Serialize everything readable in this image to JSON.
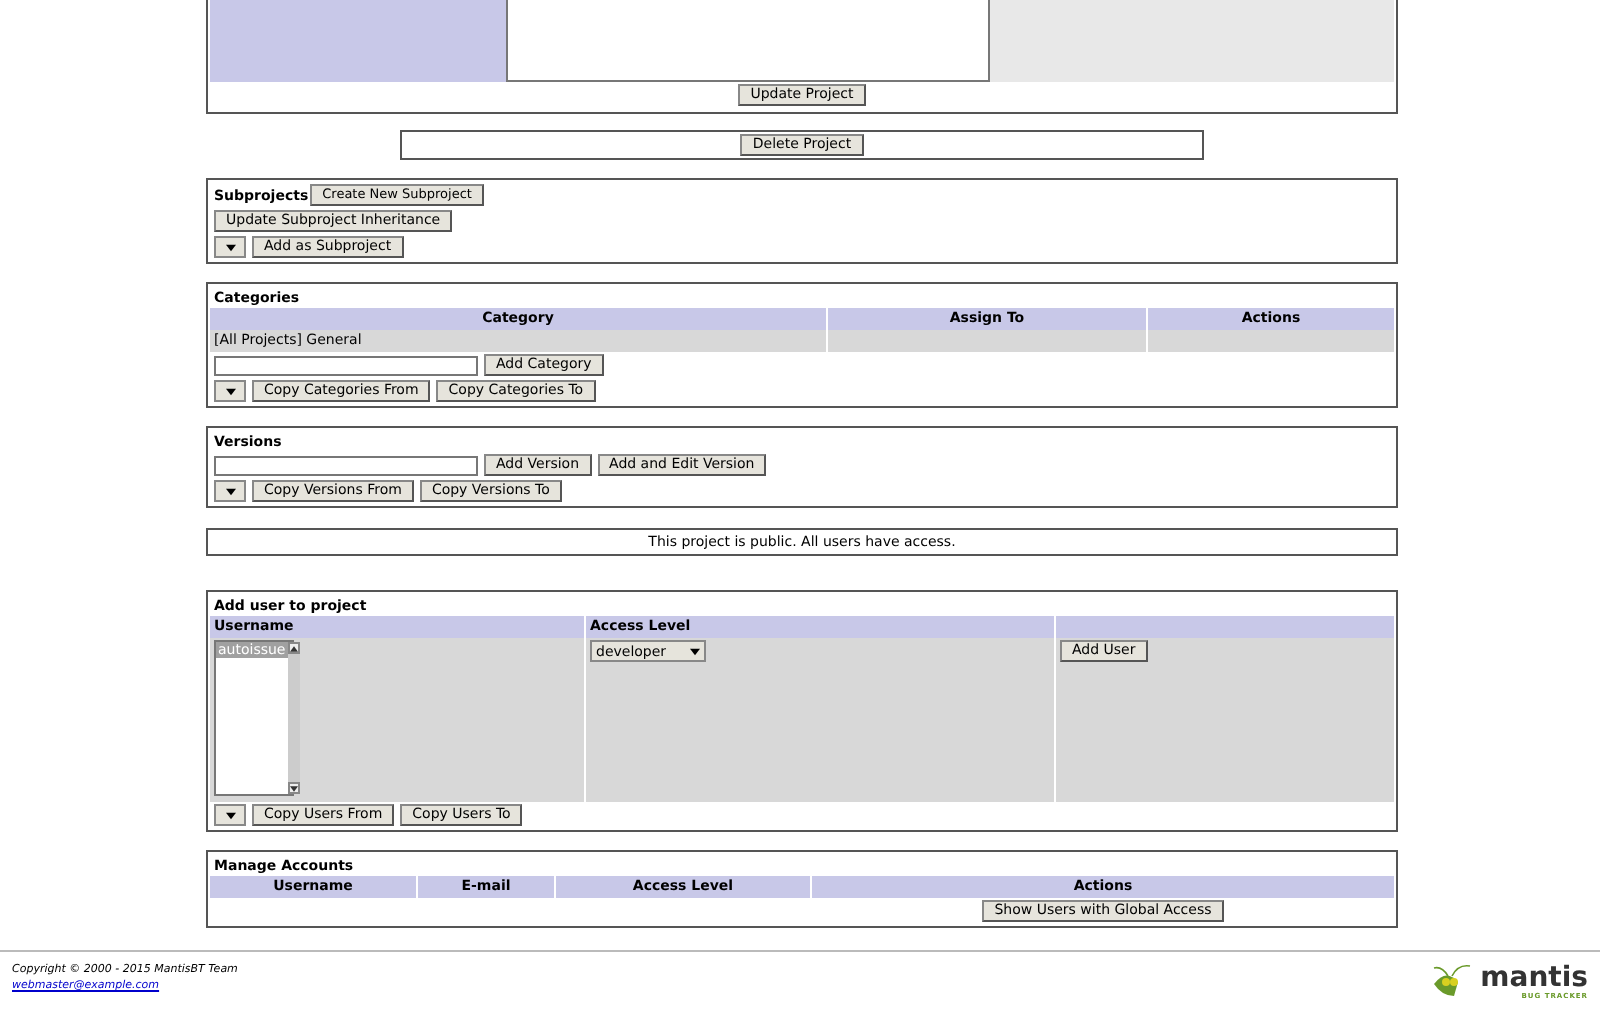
{
  "project_form": {
    "update_button": "Update Project"
  },
  "delete_button": "Delete Project",
  "subprojects": {
    "title": "Subprojects",
    "create_button": "Create New Subproject",
    "inheritance_button": "Update Subproject Inheritance",
    "add_button": "Add as Subproject"
  },
  "categories": {
    "title": "Categories",
    "columns": [
      "Category",
      "Assign To",
      "Actions"
    ],
    "rows": [
      {
        "category": "[All Projects] General"
      }
    ],
    "add_button": "Add Category",
    "copy_from_button": "Copy Categories From",
    "copy_to_button": "Copy Categories To"
  },
  "versions": {
    "title": "Versions",
    "add_button": "Add Version",
    "add_edit_button": "Add and Edit Version",
    "copy_from_button": "Copy Versions From",
    "copy_to_button": "Copy Versions To"
  },
  "access_notice": "This project is public. All users have access.",
  "add_user": {
    "title": "Add user to project",
    "columns": [
      "Username",
      "Access Level"
    ],
    "users": [
      {
        "name": "autoissue",
        "selected": true
      }
    ],
    "access_level": "developer",
    "add_button": "Add User",
    "copy_from_button": "Copy Users From",
    "copy_to_button": "Copy Users To"
  },
  "manage_accounts": {
    "title": "Manage Accounts",
    "columns": [
      "Username",
      "E-mail",
      "Access Level",
      "Actions"
    ],
    "show_button": "Show Users with Global Access"
  },
  "footer": {
    "copyright": "Copyright © 2000 - 2015 MantisBT Team",
    "email": "webmaster@example.com",
    "logo_name": "mantis",
    "logo_tagline": "BUG TRACKER"
  }
}
